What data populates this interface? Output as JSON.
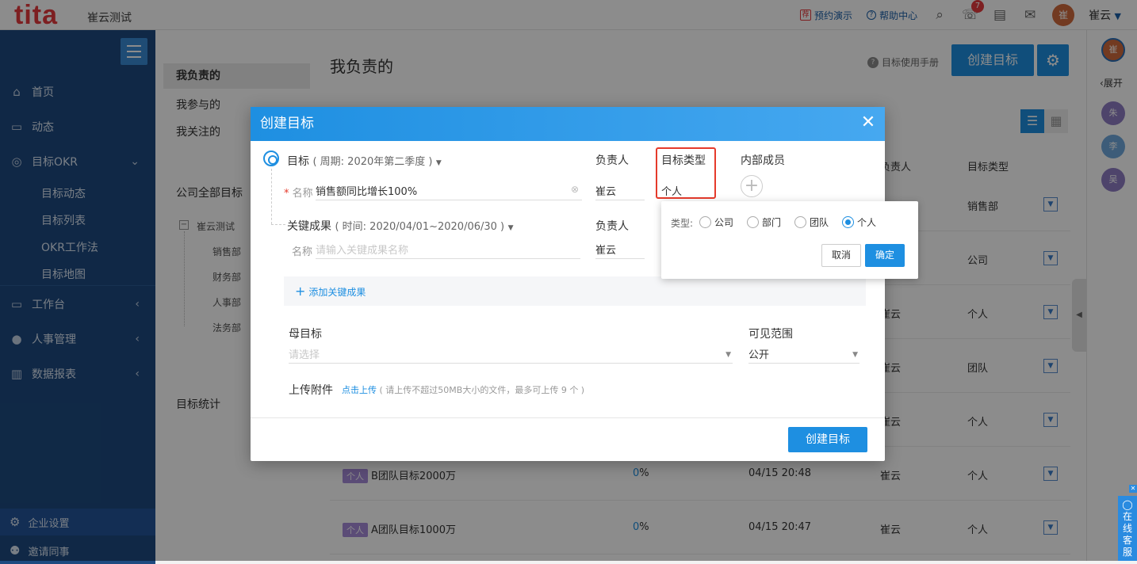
{
  "topbar": {
    "logo": "tita",
    "company": "崔云测试",
    "demo_badge": "荐",
    "demo": "预约演示",
    "help": "帮助中心",
    "notify_count": "7",
    "user_avatar": "崔",
    "user_name": "崔云"
  },
  "sidebar": {
    "items": [
      {
        "label": "首页",
        "icon": "home-icon"
      },
      {
        "label": "动态",
        "icon": "message-icon"
      },
      {
        "label": "目标OKR",
        "icon": "target-icon"
      },
      {
        "label": "工作台",
        "icon": "desktop-icon"
      },
      {
        "label": "人事管理",
        "icon": "user-icon"
      },
      {
        "label": "数据报表",
        "icon": "chart-icon"
      }
    ],
    "okr_sub": [
      "目标动态",
      "目标列表",
      "OKR工作法",
      "目标地图"
    ],
    "bottom": [
      "企业设置",
      "邀请同事"
    ]
  },
  "subnav": {
    "items": [
      "我负责的",
      "我参与的",
      "我关注的"
    ],
    "section_company": "公司全部目标",
    "tree_root": "崔云测试",
    "tree_children": [
      "销售部",
      "财务部",
      "人事部",
      "法务部"
    ],
    "section_stats": "目标统计"
  },
  "main": {
    "title": "我负责的",
    "manual": "目标使用手册",
    "create_btn": "创建目标",
    "columns": {
      "owner": "负责人",
      "type": "目标类型"
    },
    "rows": [
      {
        "name": "",
        "progress": "",
        "time": "",
        "owner": "",
        "type": "销售部"
      },
      {
        "name": "",
        "progress": "",
        "time": "",
        "owner": "",
        "type": "公司"
      },
      {
        "name": "",
        "progress": "",
        "time": "",
        "owner": "崔云",
        "type": "个人"
      },
      {
        "name": "",
        "progress": "",
        "time": "",
        "owner": "崔云",
        "type": "团队"
      },
      {
        "name": "",
        "progress": "",
        "time": "",
        "owner": "崔云",
        "type": "个人"
      },
      {
        "tag": "个人",
        "name": "B团队目标2000万",
        "progress_num": "0",
        "progress_unit": "%",
        "time": "04/15 20:48",
        "owner": "崔云",
        "type": "个人"
      },
      {
        "tag": "个人",
        "name": "A团队目标1000万",
        "progress_num": "0",
        "progress_unit": "%",
        "time": "04/15 20:47",
        "owner": "崔云",
        "type": "个人"
      }
    ]
  },
  "rightbar": {
    "me": "崔",
    "expand": "展开",
    "members": [
      {
        "name": "朱",
        "color": "#8e7cc3"
      },
      {
        "name": "李",
        "color": "#6fa8dc"
      },
      {
        "name": "吴",
        "color": "#8e7cc3"
      }
    ],
    "chat": [
      "在",
      "线",
      "客",
      "服"
    ]
  },
  "modal": {
    "title": "创建目标",
    "objective_label": "目标",
    "objective_period": "( 周期: 2020年第二季度 )",
    "owner_label": "负责人",
    "type_label": "目标类型",
    "members_label": "内部成员",
    "name_label": "名称",
    "name_value": "销售额同比增长100%",
    "owner_value": "崔云",
    "type_value": "个人",
    "kr_label": "关键成果",
    "kr_period": "( 时间: 2020/04/01~2020/06/30 )",
    "kr_owner_label": "负责人",
    "kr_name_label": "名称",
    "kr_name_placeholder": "请输入关键成果名称",
    "kr_owner_value": "崔云",
    "add_kr": "添加关键成果",
    "parent_label": "母目标",
    "parent_placeholder": "请选择",
    "visibility_label": "可见范围",
    "visibility_value": "公开",
    "upload_label": "上传附件",
    "upload_link": "点击上传",
    "upload_hint": "( 请上传不超过50MB大小的文件，最多可上传 9 个 )",
    "submit": "创建目标"
  },
  "popover": {
    "label": "类型:",
    "options": [
      "公司",
      "部门",
      "团队",
      "个人"
    ],
    "selected": "个人",
    "cancel": "取消",
    "ok": "确定"
  },
  "colors": {
    "brand_red": "#e4393c",
    "primary": "#1e8fe1",
    "sidebar": "#1e4a80",
    "highlight": "#e53a2b"
  }
}
